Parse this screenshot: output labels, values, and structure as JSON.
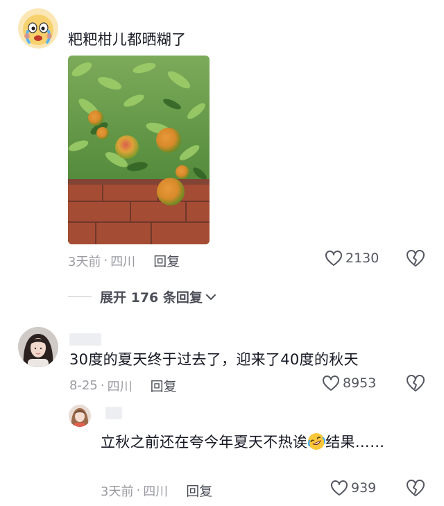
{
  "comments": [
    {
      "text": "粑粑柑儿都晒糊了",
      "time": "3天前",
      "location": "四川",
      "reply_label": "回复",
      "likes": "2130",
      "avatar_icon": "crying-emoji-avatar"
    },
    {
      "text": "30度的夏天终于过去了，迎来了40度的秋天",
      "time": "8-25",
      "location": "四川",
      "reply_label": "回复",
      "likes": "8953",
      "avatar_icon": "girl-photo-avatar"
    }
  ],
  "expand": {
    "label": "展开 176 条回复"
  },
  "reply": {
    "text_before": "立秋之前还在夸今年夏天不热诶",
    "text_after": "结果……",
    "emoji_icon": "rolling-laughing-emoji",
    "time": "3天前",
    "location": "四川",
    "reply_label": "回复",
    "likes": "939",
    "avatar_icon": "girl-photo-avatar-small"
  },
  "separator": "·",
  "colors": {
    "text": "#161823",
    "meta": "#9a9ba1",
    "reply": "#4b4d57"
  }
}
